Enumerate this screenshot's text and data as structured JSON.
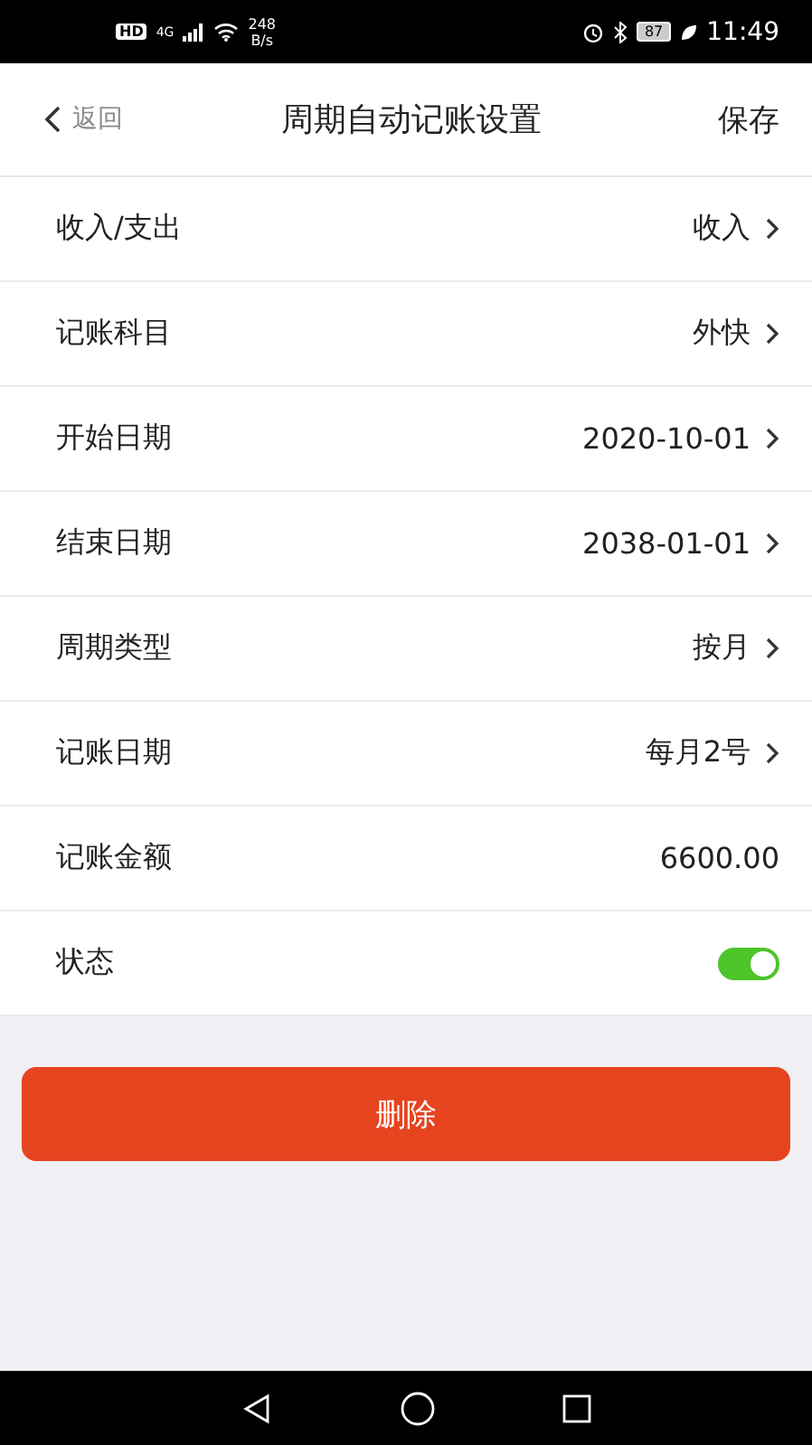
{
  "status_bar": {
    "network_badge": "HD",
    "network_type": "4G",
    "speed_value": "248",
    "speed_unit": "B/s",
    "battery": "87",
    "time": "11:49"
  },
  "header": {
    "back": "返回",
    "title": "周期自动记账设置",
    "save": "保存"
  },
  "rows": [
    {
      "kind": "link",
      "label": "收入/支出",
      "value": "收入"
    },
    {
      "kind": "link",
      "label": "记账科目",
      "value": "外快"
    },
    {
      "kind": "link",
      "label": "开始日期",
      "value": "2020-10-01"
    },
    {
      "kind": "link",
      "label": "结束日期",
      "value": "2038-01-01"
    },
    {
      "kind": "link",
      "label": "周期类型",
      "value": "按月"
    },
    {
      "kind": "link",
      "label": "记账日期",
      "value": "每月2号"
    },
    {
      "kind": "plain",
      "label": "记账金额",
      "value": "6600.00"
    },
    {
      "kind": "toggle",
      "label": "状态",
      "on": true
    }
  ],
  "delete_button": "删除"
}
